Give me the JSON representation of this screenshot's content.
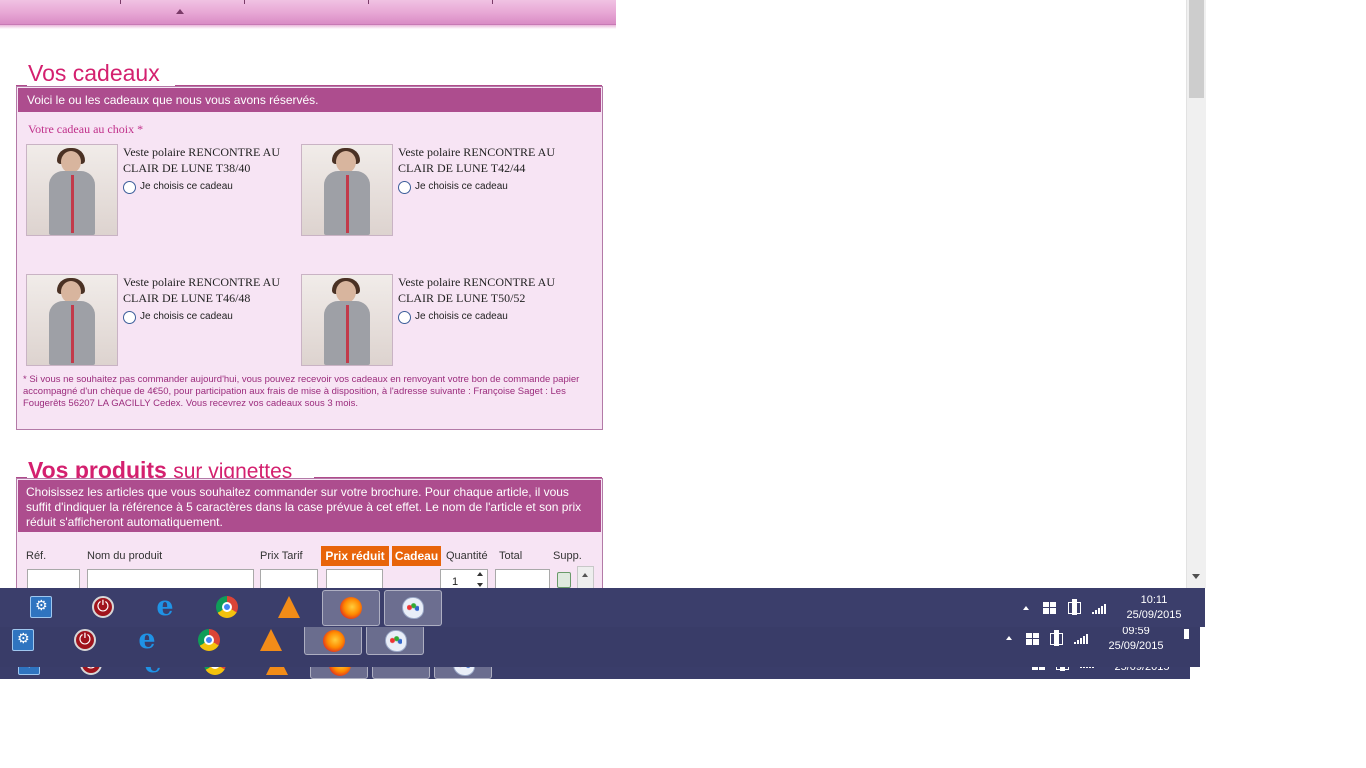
{
  "gifts_section": {
    "title": "Vos cadeaux",
    "header_text": "Voici le ou les cadeaux que nous vous avons réservés.",
    "choice_label": "Votre cadeau au choix *",
    "radio_label": "Je choisis ce cadeau",
    "items": [
      {
        "name": "Veste polaire RENCONTRE AU CLAIR DE LUNE T38/40"
      },
      {
        "name": "Veste polaire RENCONTRE AU CLAIR DE LUNE T42/44"
      },
      {
        "name": "Veste polaire RENCONTRE AU CLAIR DE LUNE T46/48"
      },
      {
        "name": "Veste polaire RENCONTRE AU CLAIR DE LUNE T50/52"
      }
    ],
    "footnote": "* Si vous ne souhaitez pas commander aujourd'hui, vous pouvez recevoir vos cadeaux en renvoyant votre bon de commande papier accompagné d'un chèque de 4€50, pour participation aux frais de mise à disposition, à l'adresse suivante : Françoise Saget : Les Fougerêts 56207 LA GACILLY Cedex. Vous recevrez vos cadeaux sous 3 mois."
  },
  "products_section": {
    "title_bold": "Vos produits",
    "title_light": "sur vignettes",
    "header_text": "Choisissez les articles que vous souhaitez commander sur votre brochure. Pour chaque article, il vous suffit d'indiquer la référence à 5 caractères dans la case prévue à cet effet. Le nom de l'article et son prix réduit s'afficheront automatiquement.",
    "columns": {
      "ref": "Réf.",
      "name": "Nom du produit",
      "price": "Prix Tarif",
      "reduced": "Prix réduit",
      "gift": "Cadeau",
      "qty": "Quantité",
      "total": "Total",
      "remove": "Supp."
    },
    "row": {
      "quantity": "1"
    }
  },
  "taskbars": [
    {
      "clock_time": "10:11",
      "clock_date": "25/09/2015"
    },
    {
      "clock_time": "09:59",
      "clock_date": "25/09/2015"
    },
    {
      "clock_date": "25/09/2015"
    }
  ],
  "taskbar_icons": [
    "settings-icon",
    "power-icon",
    "internet-explorer-icon",
    "chrome-icon",
    "vlc-icon",
    "firefox-icon",
    "paint-icon"
  ],
  "colors": {
    "accent_pink": "#d4206f",
    "panel_header": "#ad4d8e",
    "panel_bg": "#f7e4f4",
    "orange_header": "#e8640a",
    "taskbar": "#3b3e6b"
  }
}
